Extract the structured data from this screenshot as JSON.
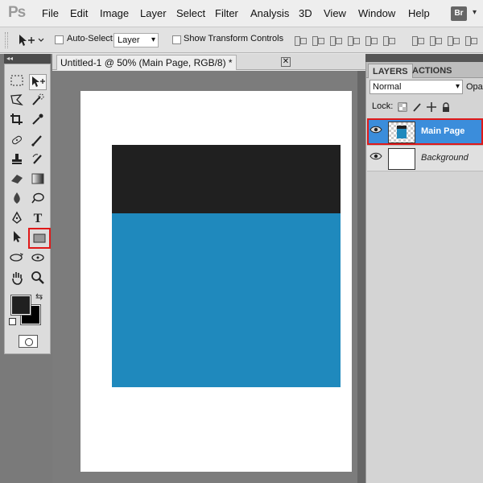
{
  "app": {
    "logo": "Ps"
  },
  "menu": [
    "File",
    "Edit",
    "Image",
    "Layer",
    "Select",
    "Filter",
    "Analysis",
    "3D",
    "View",
    "Window",
    "Help"
  ],
  "menu_right": {
    "bridge": "Br"
  },
  "options_bar": {
    "auto_select_label": "Auto-Select:",
    "auto_select_value": "Layer",
    "show_transform_label": "Show Transform Controls"
  },
  "document": {
    "tab_title": "Untitled-1 @ 50% (Main Page, RGB/8) *",
    "close_label": "✕"
  },
  "colors": {
    "foreground": "#202020",
    "background": "#000000",
    "rect_top": "#202020",
    "rect_bottom": "#1f89bd",
    "highlight_outline": "#e01818",
    "selected_layer": "#3b8ddb"
  },
  "tools": [
    {
      "name": "rectangular-marquee",
      "glyph": "⬚"
    },
    {
      "name": "move",
      "glyph": "✥"
    },
    {
      "name": "lasso",
      "glyph": "ʘ"
    },
    {
      "name": "quick-selection",
      "glyph": "✎"
    },
    {
      "name": "crop",
      "glyph": "⌗"
    },
    {
      "name": "eyedropper",
      "glyph": "✐"
    },
    {
      "name": "spot-healing",
      "glyph": "✚"
    },
    {
      "name": "brush",
      "glyph": "✏"
    },
    {
      "name": "clone-stamp",
      "glyph": "⊥"
    },
    {
      "name": "history-brush",
      "glyph": "↺"
    },
    {
      "name": "eraser",
      "glyph": "▰"
    },
    {
      "name": "gradient",
      "glyph": "▦"
    },
    {
      "name": "blur",
      "glyph": "◆"
    },
    {
      "name": "dodge",
      "glyph": "◔"
    },
    {
      "name": "pen",
      "glyph": "✒"
    },
    {
      "name": "type",
      "glyph": "T"
    },
    {
      "name": "path-selection",
      "glyph": "➤"
    },
    {
      "name": "rectangle-shape",
      "glyph": "▭"
    },
    {
      "name": "3d-rotate",
      "glyph": "⟳"
    },
    {
      "name": "3d-orbit",
      "glyph": "⟲"
    },
    {
      "name": "hand",
      "glyph": "✋"
    },
    {
      "name": "zoom",
      "glyph": "🔍"
    }
  ],
  "layers_panel": {
    "tabs": [
      "LAYERS",
      "ACTIONS"
    ],
    "blend_mode": "Normal",
    "opacity_label": "Opac",
    "lock_label": "Lock:",
    "layers": [
      {
        "name": "Main Page",
        "selected": true,
        "visible": true
      },
      {
        "name": "Background",
        "selected": false,
        "visible": true
      }
    ]
  }
}
